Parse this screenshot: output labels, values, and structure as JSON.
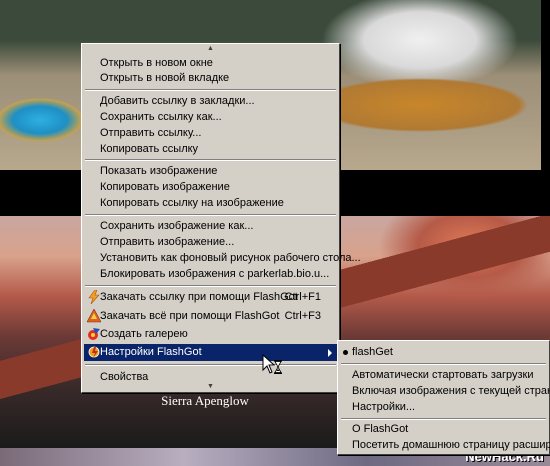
{
  "caption": "Sierra Apenglow",
  "watermark": "NewHack.Ru",
  "menu": {
    "group1": [
      "Открыть в новом окне",
      "Открыть в новой вкладке"
    ],
    "group2": [
      "Добавить ссылку в закладки...",
      "Сохранить ссылку как...",
      "Отправить ссылку...",
      "Копировать ссылку"
    ],
    "group3": [
      "Показать изображение",
      "Копировать изображение",
      "Копировать ссылку на изображение"
    ],
    "group4": [
      "Сохранить изображение как...",
      "Отправить изображение...",
      "Установить как фоновый рисунок рабочего стола...",
      "Блокировать изображения с parkerlab.bio.u..."
    ],
    "flashgot": {
      "download_link": "Закачать ссылку при помощи FlashGot",
      "download_link_shortcut": "Ctrl+F1",
      "download_all": "Закачать всё при помощи FlashGot",
      "download_all_shortcut": "Ctrl+F3",
      "create_gallery": "Создать галерею",
      "settings": "Настройки FlashGot"
    },
    "properties": "Свойства"
  },
  "submenu": {
    "flashget": "flashGet",
    "auto_start": "Автоматически стартовать загрузки",
    "include_images": "Включая изображения с текущей страницы",
    "settings": "Настройки...",
    "about": "О FlashGot",
    "homepage": "Посетить домашнюю страницу расширения"
  },
  "colors": {
    "menu_bg": "#d4d0c8",
    "highlight": "#0a246a"
  },
  "icons": [
    "flashgot-lightning-icon",
    "flashgot-download-all-icon",
    "gallery-icon",
    "flashgot-settings-icon",
    "hourglass-cursor-icon"
  ]
}
